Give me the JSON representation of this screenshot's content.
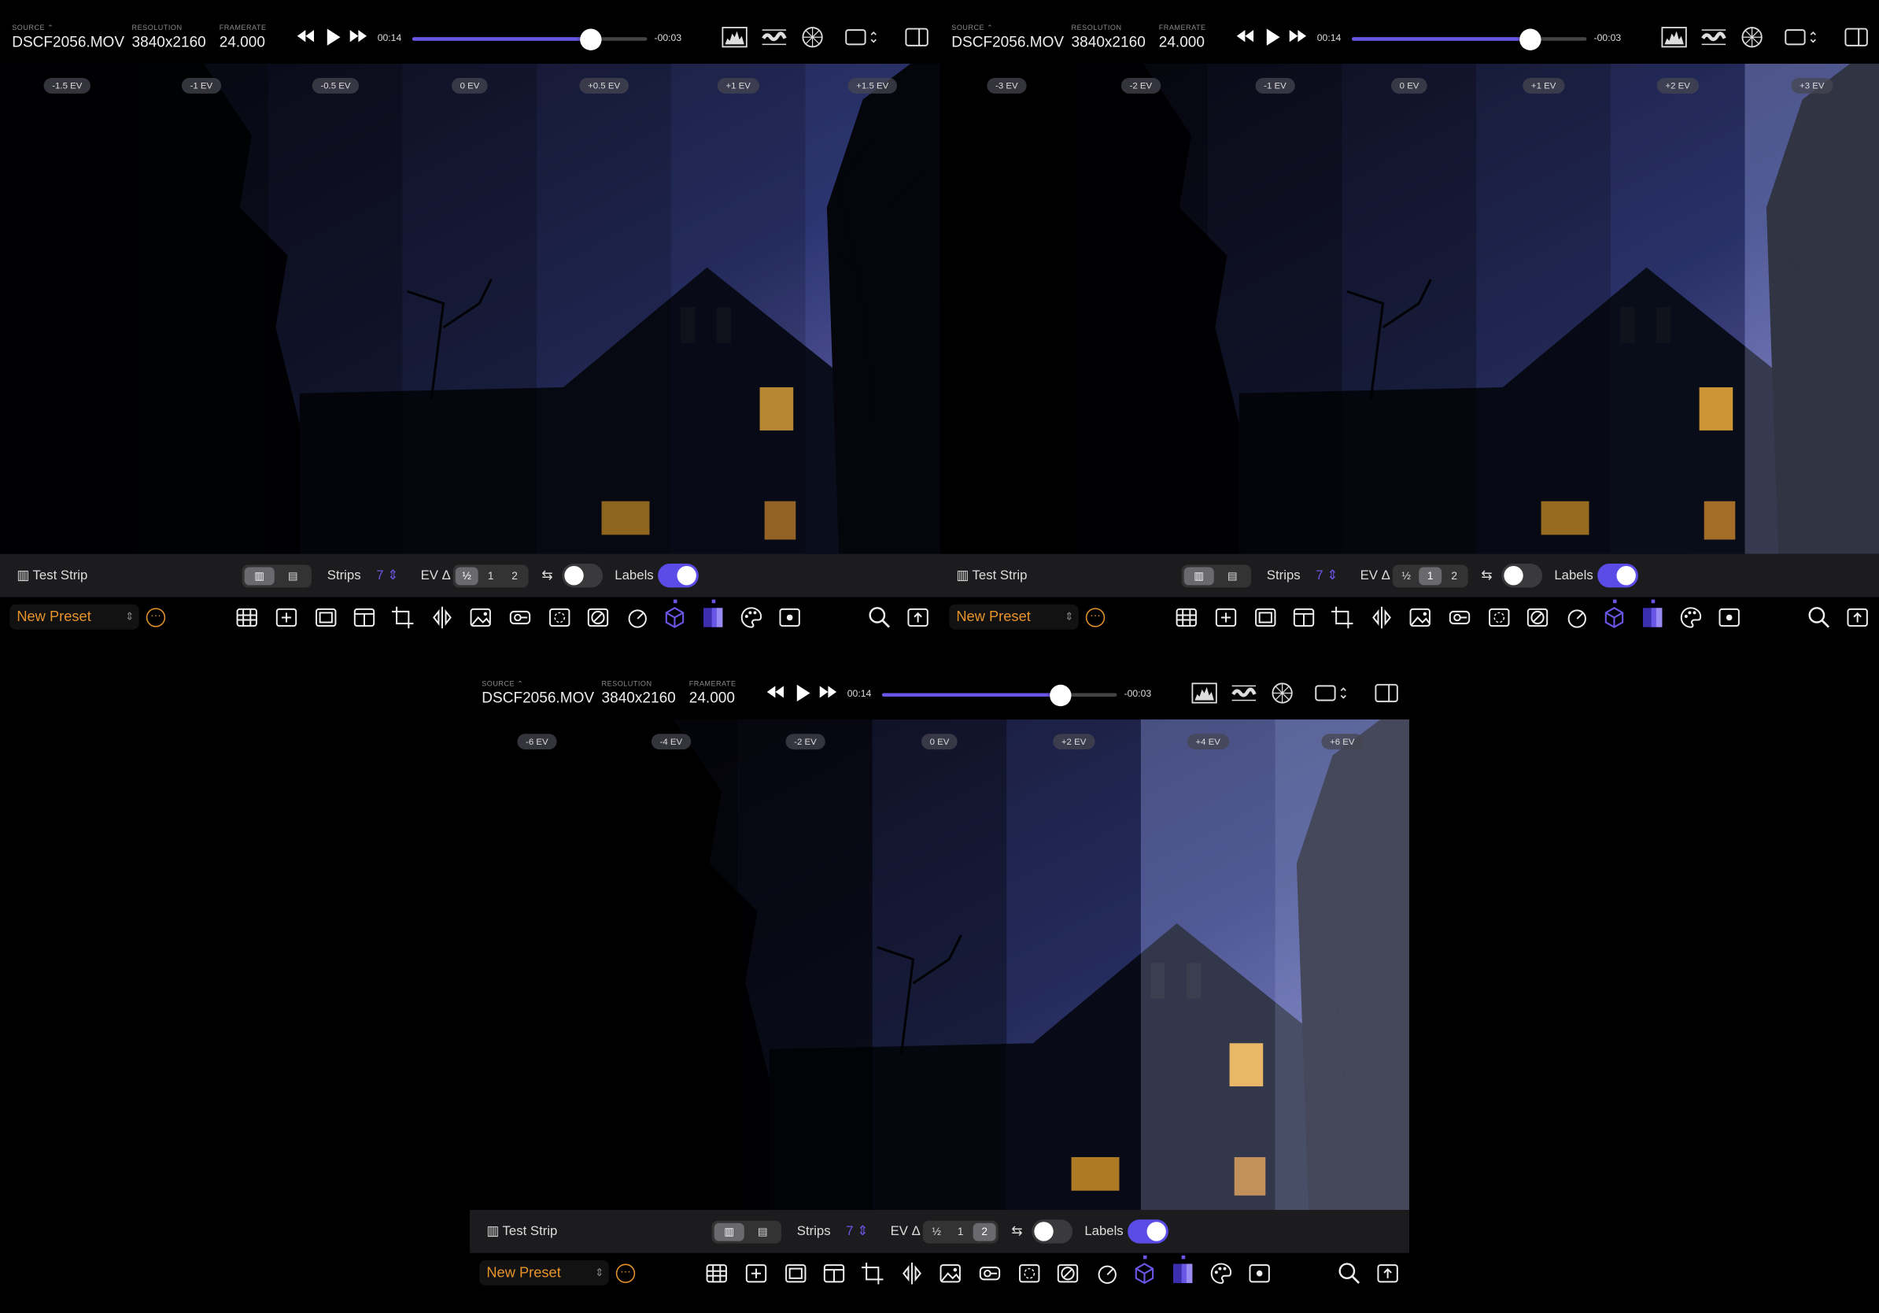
{
  "colors": {
    "accent": "#6a56e6",
    "preset_orange": "#e8932a",
    "toggle_on": "#5b4ce8"
  },
  "panels": [
    {
      "source_label": "SOURCE",
      "source": "DSCF2056.MOV",
      "resolution_label": "RESOLUTION",
      "resolution": "3840x2160",
      "framerate_label": "FRAMERATE",
      "framerate": "24.000",
      "time_elapsed": "00:14",
      "time_remaining": "-00:03",
      "progress": 0.76,
      "ev_labels": [
        "-1.5 EV",
        "-1 EV",
        "-0.5 EV",
        "0 EV",
        "+0.5 EV",
        "+1 EV",
        "+1.5 EV"
      ],
      "test_strip_label": "Test Strip",
      "strips_label": "Strips",
      "strips_value": "7",
      "ev_delta_label": "EV Δ",
      "ev_options": [
        "½",
        "1",
        "2"
      ],
      "ev_selected": "½",
      "labels_label": "Labels",
      "preset_name": "New Preset"
    },
    {
      "source_label": "SOURCE",
      "source": "DSCF2056.MOV",
      "resolution_label": "RESOLUTION",
      "resolution": "3840x2160",
      "framerate_label": "FRAMERATE",
      "framerate": "24.000",
      "time_elapsed": "00:14",
      "time_remaining": "-00:03",
      "progress": 0.76,
      "ev_labels": [
        "-3 EV",
        "-2 EV",
        "-1 EV",
        "0 EV",
        "+1 EV",
        "+2 EV",
        "+3 EV"
      ],
      "test_strip_label": "Test Strip",
      "strips_label": "Strips",
      "strips_value": "7",
      "ev_delta_label": "EV Δ",
      "ev_options": [
        "½",
        "1",
        "2"
      ],
      "ev_selected": "1",
      "labels_label": "Labels",
      "preset_name": "New Preset"
    },
    {
      "source_label": "SOURCE",
      "source": "DSCF2056.MOV",
      "resolution_label": "RESOLUTION",
      "resolution": "3840x2160",
      "framerate_label": "FRAMERATE",
      "framerate": "24.000",
      "time_elapsed": "00:14",
      "time_remaining": "-00:03",
      "progress": 0.76,
      "ev_labels": [
        "-6 EV",
        "-4 EV",
        "-2 EV",
        "0 EV",
        "+2 EV",
        "+4 EV",
        "+6 EV"
      ],
      "test_strip_label": "Test Strip",
      "strips_label": "Strips",
      "strips_value": "7",
      "ev_delta_label": "EV Δ",
      "ev_options": [
        "½",
        "1",
        "2"
      ],
      "ev_selected": "2",
      "labels_label": "Labels",
      "preset_name": "New Preset"
    }
  ],
  "toolbar_icons": [
    "histogram-icon",
    "waveform-icon",
    "vectorscope-icon",
    "aspect-ratio-icon",
    "sidebar-icon"
  ],
  "bottom_icons": [
    "grid-icon",
    "crosshair-icon",
    "frame-guide-icon",
    "layout-icon",
    "crop-icon",
    "flip-icon",
    "image-icon",
    "lut-icon",
    "focus-peaking-icon",
    "zebra-icon",
    "exposure-meter-icon",
    "cube-lut-icon",
    "test-strip-icon",
    "palette-icon",
    "record-icon"
  ]
}
